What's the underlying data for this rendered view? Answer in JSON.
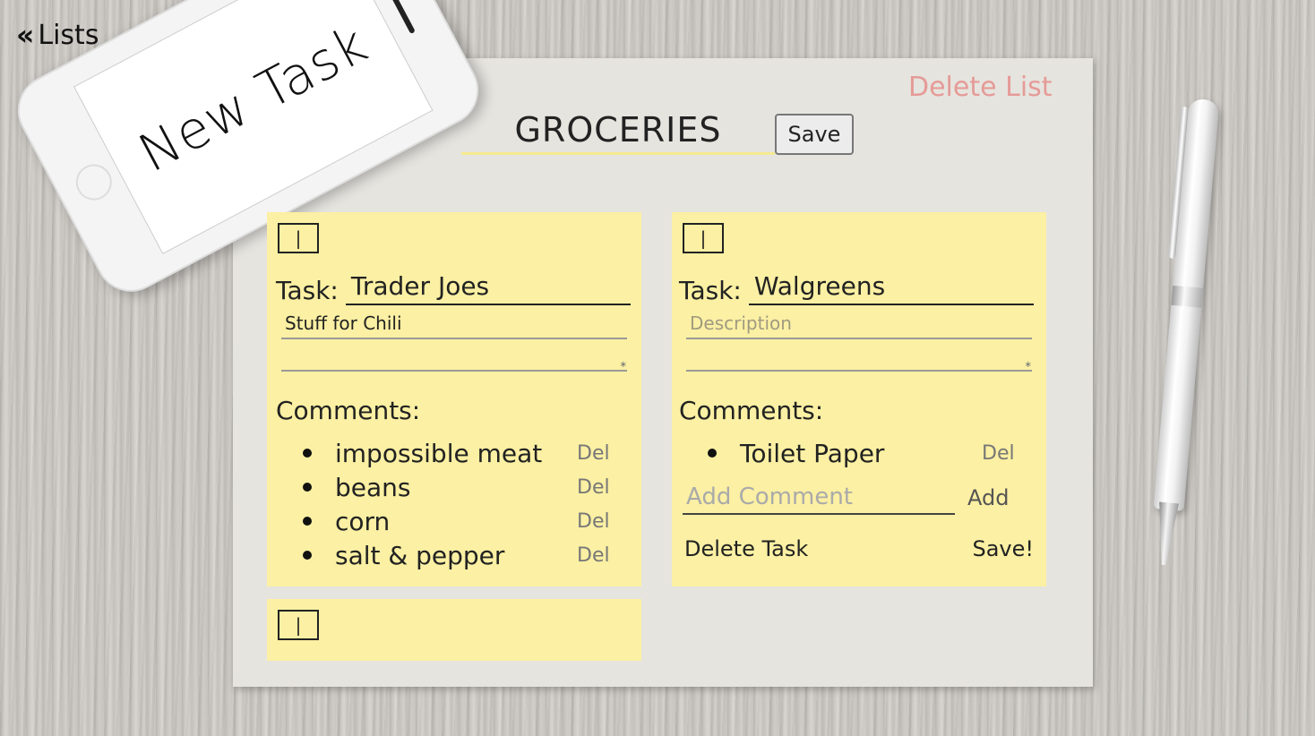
{
  "nav": {
    "back_label": "Lists"
  },
  "phone": {
    "screen_text": "New Task"
  },
  "list": {
    "title": "GROCERIES",
    "save_label": "Save",
    "delete_label": "Delete List"
  },
  "cards": [
    {
      "handle": "|",
      "task_label": "Task:",
      "task_value": "Trader Joes",
      "description": "Stuff for Chili",
      "comments_label": "Comments:",
      "comments": [
        {
          "text": "impossible meat",
          "del": "Del"
        },
        {
          "text": "beans",
          "del": "Del"
        },
        {
          "text": "corn",
          "del": "Del"
        },
        {
          "text": "salt & pepper",
          "del": "Del"
        }
      ]
    },
    {
      "handle": "|",
      "task_label": "Task:",
      "task_value": "Walgreens",
      "description_placeholder": "Description",
      "comments_label": "Comments:",
      "comments": [
        {
          "text": "Toilet Paper",
          "del": "Del"
        }
      ],
      "add_comment_placeholder": "Add Comment",
      "add_label": "Add",
      "delete_task_label": "Delete Task",
      "save_task_label": "Save!"
    },
    {
      "handle": "|"
    }
  ],
  "colors": {
    "card_bg": "#fbf0a3",
    "delete_list": "#e59b97",
    "title_underline": "#f5ea8f"
  }
}
